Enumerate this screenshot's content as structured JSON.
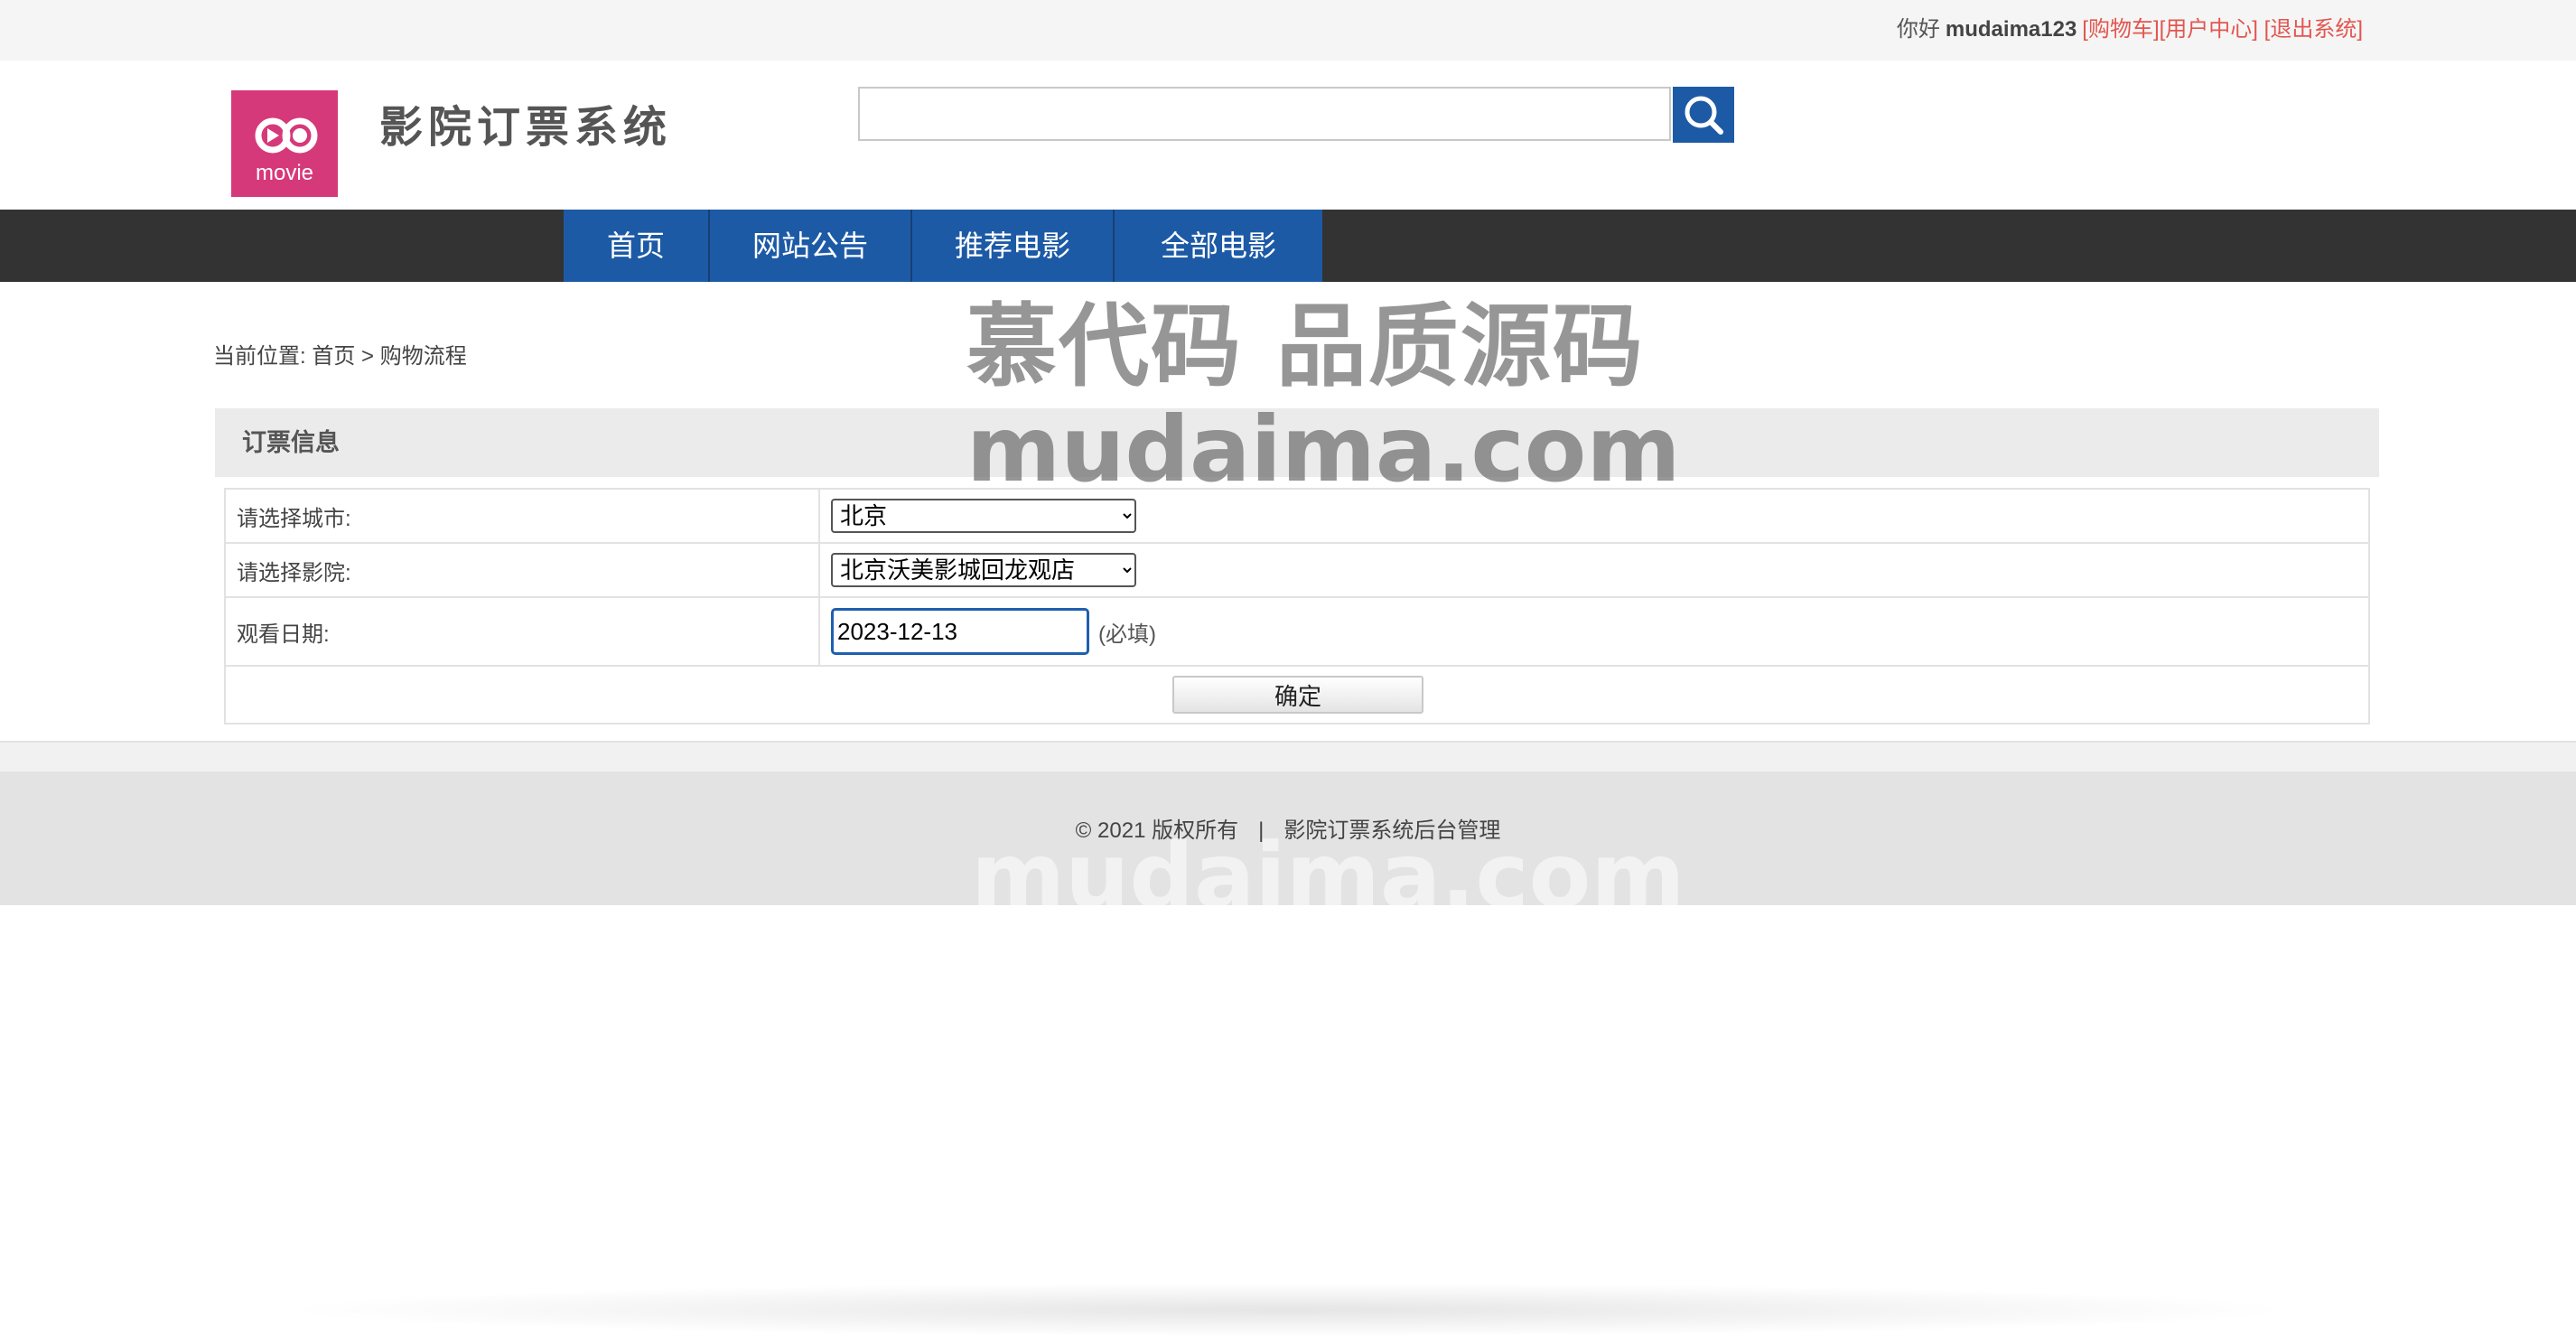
{
  "topbar": {
    "greeting": "你好",
    "username": "mudaima123",
    "cart_link": "[购物车]",
    "user_center_link": "[用户中心]",
    "logout_link": "[退出系统]",
    "link_color": "#e2564f"
  },
  "header": {
    "logo_text": "movie",
    "site_title": "影院订票系统",
    "search": {
      "placeholder": "",
      "value": ""
    },
    "search_icon": "search-icon"
  },
  "nav": {
    "items": [
      {
        "label": "首页"
      },
      {
        "label": "网站公告"
      },
      {
        "label": "推荐电影"
      },
      {
        "label": "全部电影"
      }
    ],
    "bar_color": "#333333",
    "active_color": "#1d5aa6"
  },
  "watermark": {
    "line1": "慕代码 品质源码",
    "line2": "mudaima.com",
    "footer_mark": "mudaima.com"
  },
  "breadcrumb": {
    "prefix": "当前位置:",
    "home": "首页",
    "separator": ">",
    "current": "购物流程"
  },
  "section": {
    "title": "订票信息"
  },
  "form": {
    "city_label": "请选择城市:",
    "city_value": "北京",
    "cinema_label": "请选择影院:",
    "cinema_value": "北京沃美影城回龙观店",
    "date_label": "观看日期:",
    "date_value": "2023-12-13",
    "required_hint": "(必填)",
    "submit_label": "确定"
  },
  "footer": {
    "copyright": "© 2021 版权所有",
    "divider": "|",
    "admin_link": "影院订票系统后台管理"
  }
}
